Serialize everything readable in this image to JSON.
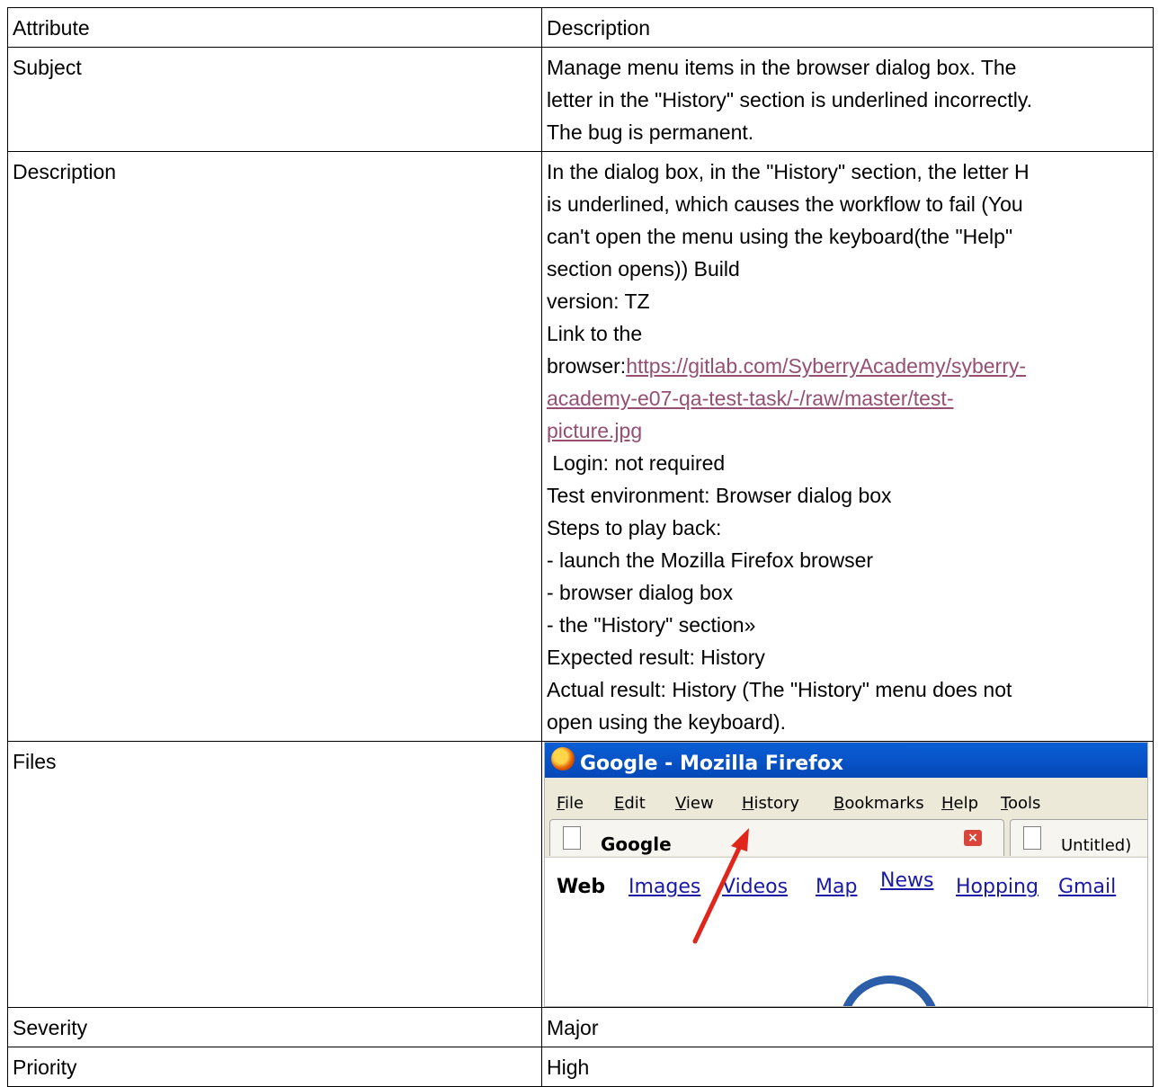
{
  "table": {
    "header": {
      "attribute": "Attribute",
      "description": "Description"
    },
    "subject": {
      "label": "Subject",
      "lines": [
        "Manage menu items in the browser dialog box. The",
        "letter in the \"History\" section is underlined incorrectly.",
        "The bug is permanent."
      ]
    },
    "description": {
      "label": "Description",
      "lines_before_link": [
        "In the dialog box, in the \"History\" section, the letter H",
        "is underlined, which causes the workflow to fail (You",
        "can't open the menu using the keyboard(the \"Help\"",
        "section opens)) Build",
        "version: TZ",
        "Link to the"
      ],
      "link_prefix": "browser:",
      "link_lines": [
        "https://gitlab.com/SyberryAcademy/syberry-",
        "academy-e07-qa-test-task/-/raw/master/test-",
        "picture.jpg"
      ],
      "lines_after_link": [
        " Login: not required",
        "Test environment: Browser dialog box",
        "Steps to play back:",
        "- launch the Mozilla Firefox browser",
        "- browser dialog box",
        "- the \"History\" section»",
        "Expected result: History",
        "Actual result: History (The \"History\" menu does not",
        "open using the keyboard)."
      ]
    },
    "files": {
      "label": "Files",
      "screenshot": {
        "window_title": "Google - Mozilla Firefox",
        "menu": [
          "File",
          "Edit",
          "View",
          "History",
          "Bookmarks",
          "Help",
          "Tools"
        ],
        "tabs": [
          "Google",
          "Untitled)"
        ],
        "links": [
          "Web",
          "Images",
          "Videos",
          "Map",
          "News",
          "Hopping",
          "Gmail"
        ],
        "arrow_color": "#e0251b"
      }
    },
    "severity": {
      "label": "Severity",
      "value": "Major"
    },
    "priority": {
      "label": "Priority",
      "value": "High"
    }
  }
}
